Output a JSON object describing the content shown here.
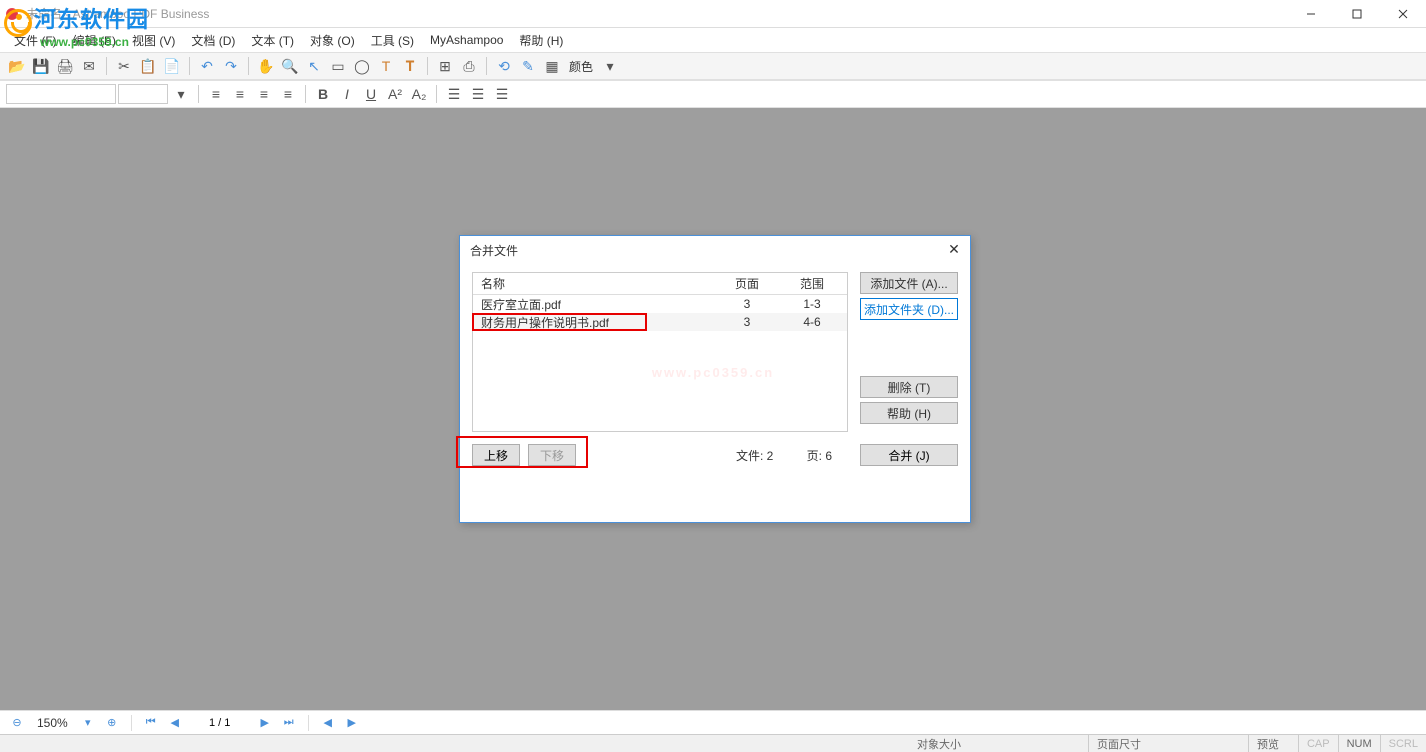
{
  "window": {
    "title": "未命名 - Ashampoo PDF Business",
    "watermark_text": "河东软件园",
    "watermark_url": "www.pc0359.cn",
    "center_watermark": "www.pc0359.cn"
  },
  "menu": {
    "file": "文件 (F)",
    "edit": "编辑 (E)",
    "view": "视图 (V)",
    "document": "文档 (D)",
    "text": "文本 (T)",
    "object": "对象 (O)",
    "tools": "工具 (S)",
    "myashampoo": "MyAshampoo",
    "help": "帮助 (H)"
  },
  "toolbar": {
    "color_label": "颜色"
  },
  "bottom": {
    "zoom": "150%",
    "page": "1 / 1"
  },
  "status": {
    "object_size": "对象大小",
    "page_size": "页面尺寸",
    "preview": "预览",
    "cap": "CAP",
    "num": "NUM",
    "scrl": "SCRL"
  },
  "dialog": {
    "title": "合并文件",
    "columns": {
      "name": "名称",
      "pages": "页面",
      "range": "范围"
    },
    "rows": [
      {
        "name": "医疗室立面.pdf",
        "pages": "3",
        "range": "1-3"
      },
      {
        "name": "财务用户操作说明书.pdf",
        "pages": "3",
        "range": "4-6"
      }
    ],
    "buttons": {
      "add_file": "添加文件 (A)...",
      "add_folder": "添加文件夹 (D)...",
      "delete": "删除 (T)",
      "help": "帮助 (H)",
      "move_up": "上移",
      "move_down": "下移",
      "merge": "合并 (J)"
    },
    "footer": {
      "files": "文件: 2",
      "pages": "页: 6"
    }
  }
}
